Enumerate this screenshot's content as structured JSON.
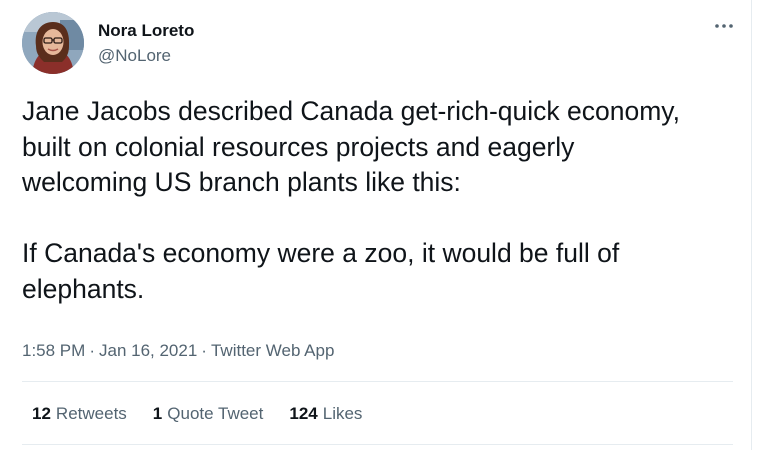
{
  "author": {
    "display_name": "Nora Loreto",
    "handle": "@NoLore"
  },
  "menu": {
    "more_icon": "more-horizontal-icon"
  },
  "tweet": {
    "text": "Jane Jacobs described Canada get-rich-quick economy,\nbuilt on colonial resources projects and eagerly\nwelcoming US branch plants like this:\n\nIf Canada's economy were a zoo, it would be full of\nelephants."
  },
  "meta": {
    "time": "1:58 PM",
    "separator": "·",
    "date": "Jan 16, 2021",
    "source": "Twitter Web App"
  },
  "stats": {
    "retweets_count": "12",
    "retweets_label": "Retweets",
    "quote_count": "1",
    "quote_label": "Quote Tweet",
    "likes_count": "124",
    "likes_label": "Likes"
  },
  "colors": {
    "primary_text": "#0f1419",
    "secondary_text": "#536471",
    "divider": "#e6ecf0"
  }
}
